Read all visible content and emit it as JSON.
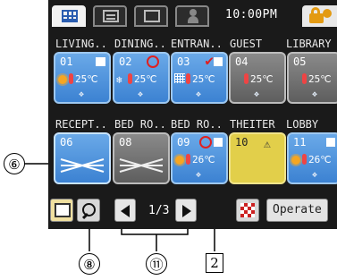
{
  "clock": "10:00PM",
  "tabs": [
    {
      "icon": "grid-view-icon",
      "active": true
    },
    {
      "icon": "list-view-icon",
      "active": false
    },
    {
      "icon": "single-view-icon",
      "active": false
    },
    {
      "icon": "user-settings-icon",
      "active": false
    }
  ],
  "rooms": [
    {
      "label": "LIVING..",
      "num": "01",
      "temp": "25℃",
      "color": "blue"
    },
    {
      "label": "DINING..",
      "num": "02",
      "temp": "25℃",
      "color": "blue"
    },
    {
      "label": "ENTRAN..",
      "num": "03",
      "temp": "25℃",
      "color": "blue"
    },
    {
      "label": "GUEST",
      "num": "04",
      "temp": "25℃",
      "color": "gray"
    },
    {
      "label": "LIBRARY",
      "num": "05",
      "temp": "25℃",
      "color": "gray"
    },
    {
      "label": "RECEPT..",
      "num": "06",
      "temp": "",
      "color": "blue"
    },
    {
      "label": "BED RO..",
      "num": "08",
      "temp": "",
      "color": "gray"
    },
    {
      "label": "BED RO..",
      "num": "09",
      "temp": "26℃",
      "color": "blue"
    },
    {
      "label": "THEITER",
      "num": "10",
      "temp": "",
      "color": "yellow"
    },
    {
      "label": "LOBBY",
      "num": "11",
      "temp": "26℃",
      "color": "blue"
    }
  ],
  "pager": {
    "page": "1/3"
  },
  "operate_label": "Operate",
  "callouts": {
    "c6": "⑥",
    "c8": "⑧",
    "c11": "⑪",
    "c2": "2"
  },
  "colors": {
    "accent_blue": "#3c82d2",
    "warning_yellow": "#e2cf4a",
    "lock_orange": "#e39a12"
  }
}
